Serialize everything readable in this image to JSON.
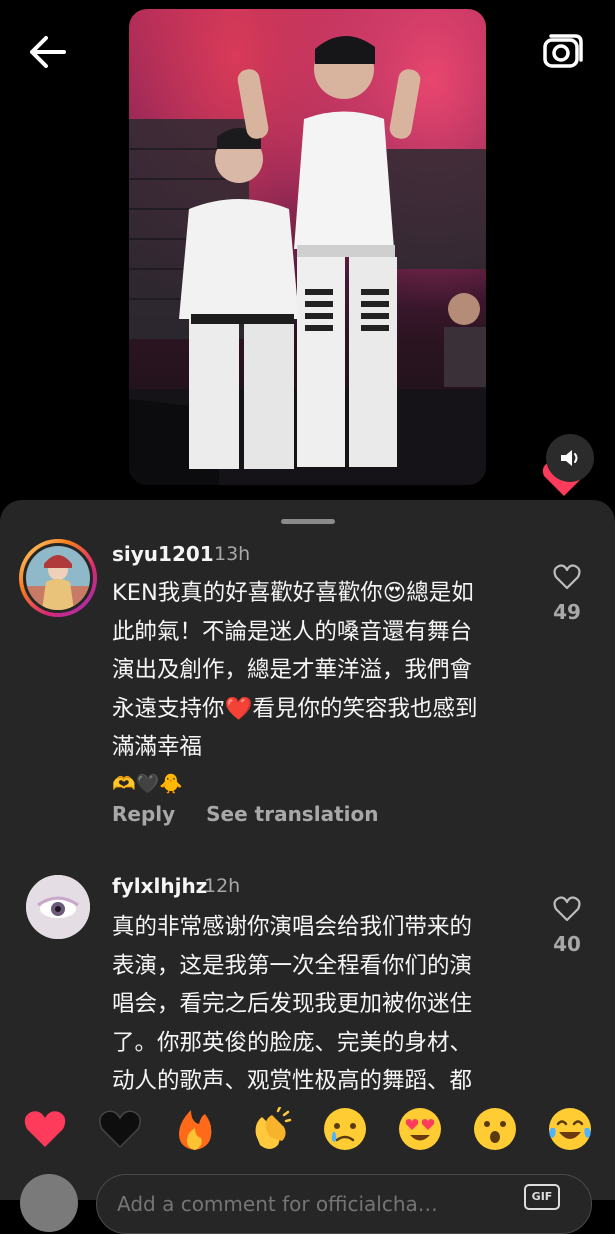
{
  "nav": {
    "back_icon": "arrow-left-icon",
    "camera_icon": "camera-icon"
  },
  "video": {
    "sound_icon": "speaker-icon"
  },
  "comments": [
    {
      "username": "siyu1201",
      "time": "13h",
      "lines": [
        "KEN我真的好喜歡好喜歡你😍總是如",
        "此帥氣！不論是迷人的嗓音還有舞台",
        "演出及創作，總是才華洋溢，我們會",
        "永遠支持你❤️看見你的笑容我也感到",
        "滿滿幸福"
      ],
      "emoji_line": "🫶🖤🐥",
      "reply_label": "Reply",
      "translate_label": "See translation",
      "likes": "49"
    },
    {
      "username": "fylxlhjhz",
      "time": "12h",
      "lines": [
        "真的非常感谢你演唱会给我们带来的",
        "表演，这是我第一次全程看你们的演",
        "唱会，看完之后发现我更加被你迷住",
        "了。你那英俊的脸庞、完美的身材、",
        "动人的歌声、观赏性极高的舞蹈、都"
      ],
      "likes": "40"
    }
  ],
  "reactions": [
    "❤️",
    "🖤",
    "🔥",
    "👏",
    "😢",
    "😍",
    "😮",
    "😂"
  ],
  "composer": {
    "placeholder": "Add a comment for officialcha…",
    "gif_label": "GIF"
  },
  "colors": {
    "sheet_bg": "#262626",
    "heart": "#ff3b5c"
  }
}
